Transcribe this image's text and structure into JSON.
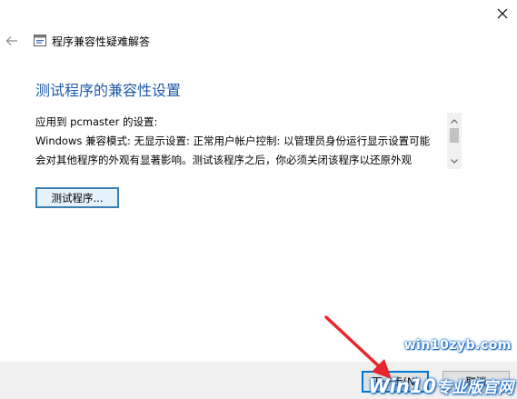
{
  "window": {
    "title": "程序兼容性疑难解答"
  },
  "page": {
    "heading": "测试程序的兼容性设置"
  },
  "settings": {
    "lines": [
      "应用到 pcmaster 的设置:",
      "Windows 兼容模式: 无显示设置: 正常用户帐户控制: 以管理员身份运行显示设置可能",
      "会对其他程序的外观有显著影响。测试该程序之后，你必须关闭该程序以还原外观"
    ]
  },
  "buttons": {
    "test_program": "测试程序...",
    "next": "下一步(N)",
    "cancel": "取消"
  },
  "watermark": {
    "url": "win10zyb.com",
    "logo_win": "Win10",
    "logo_cn": "专业版官网"
  },
  "colors": {
    "heading": "#1e5ba8",
    "focus_border": "#0078d7",
    "arrow": "#e8262d"
  },
  "icons": {
    "close": "close-icon",
    "back": "back-arrow-icon",
    "app": "troubleshooter-icon"
  }
}
